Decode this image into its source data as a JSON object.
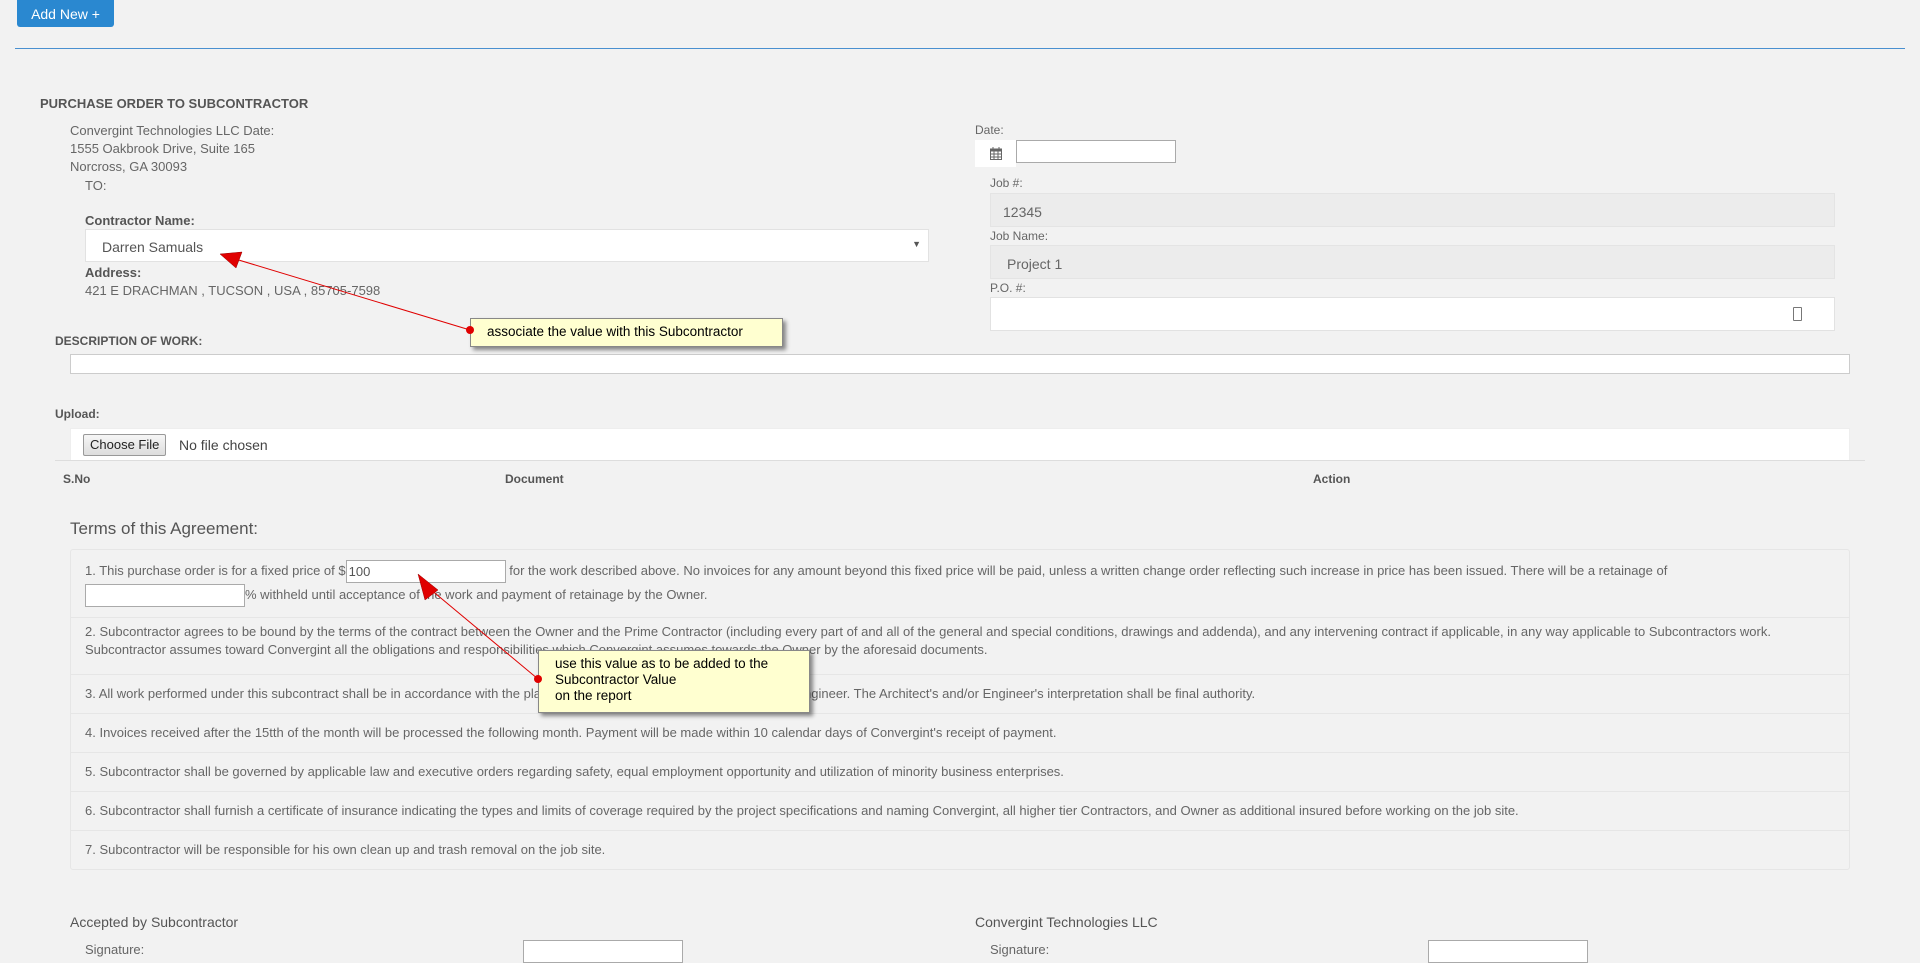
{
  "toolbar": {
    "add_new_label": "Add New +"
  },
  "form": {
    "title": "PURCHASE ORDER TO SUBCONTRACTOR",
    "company_lines": [
      "Convergint Technologies LLC Date:",
      "1555 Oakbrook Drive, Suite 165",
      "Norcross, GA 30093"
    ],
    "to_label": "TO:",
    "contractor_label": "Contractor Name:",
    "contractor_value": "Darren Samuals",
    "address_label": "Address:",
    "address_value": "421 E DRACHMAN , TUCSON , USA , 85705-7598",
    "date_label": "Date:",
    "date_value": "",
    "job_no_label": "Job #:",
    "job_no_value": "12345",
    "job_name_label": "Job Name:",
    "job_name_value": "Project 1",
    "po_label": "P.O. #:",
    "po_value": "",
    "description_label": "DESCRIPTION OF WORK:",
    "upload_label": "Upload:",
    "choose_file_label": "Choose File",
    "no_file_label": "No file chosen",
    "table_headers": [
      "S.No",
      "Document",
      "Action"
    ]
  },
  "terms": {
    "heading": "Terms of this Agreement:",
    "t1_pre": "1. This purchase order is for a fixed price of $",
    "price_value": "100",
    "t1_post": " for the work described above. No invoices for any amount beyond this fixed price will be paid, unless a written change order reflecting such increase in price has been issued. There will be a retainage of",
    "retainage_value": "",
    "t1_tail": "% withheld until acceptance of the work and payment of retainage by the Owner.",
    "items": [
      "2. Subcontractor agrees to be bound by the terms of the contract between the Owner and the Prime Contractor (including every part of and all of the general and special conditions, drawings and addenda), and any intervening contract if applicable, in any way applicable to Subcontractors work. Subcontractor assumes toward Convergint all the obligations and responsibilities which Convergint assumes towards the Owner by the aforesaid documents.",
      "3. All work performed under this subcontract shall be in accordance with the plans and specifications of the Architect and/or Engineer. The Architect's and/or Engineer's interpretation shall be final authority.",
      "4. Invoices received after the 15tth of the month will be processed the following month. Payment will be made within 10 calendar days of Convergint's receipt of payment.",
      "5. Subcontractor shall be governed by applicable law and executive orders regarding safety, equal employment opportunity and utilization of minority business enterprises.",
      "6. Subcontractor shall furnish a certificate of insurance indicating the types and limits of coverage required by the project specifications and naming Convergint, all higher tier Contractors, and Owner as additional insured before working on the job site.",
      "7. Subcontractor will be responsible for his own clean up and trash removal on the job site."
    ]
  },
  "signatures": {
    "left_heading": "Accepted by Subcontractor",
    "right_heading": "Convergint Technologies LLC",
    "signature_label": "Signature:"
  },
  "annotations": {
    "callout1": "associate the value with this Subcontractor",
    "callout2_lines": [
      "use this value as to be added to the",
      "Subcontractor Value",
      "on the report"
    ]
  },
  "colors": {
    "accent": "#2a88d0",
    "callout_bg": "#ffffd0",
    "arrow": "#e00000"
  }
}
